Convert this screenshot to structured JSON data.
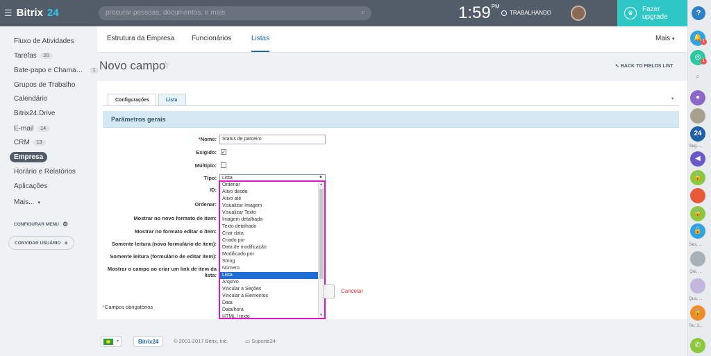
{
  "topbar": {
    "logo_text": "Bitrix",
    "logo_num": "24",
    "search_placeholder": "procurar pessoas, documentos, e mais",
    "time": "1:59",
    "ampm": "PM",
    "work_status": "TRABALHANDO",
    "upgrade_label": "Fazer upgrade",
    "help": "?"
  },
  "sidebar": {
    "items": [
      {
        "label": "Fluxo de Atividades",
        "count": ""
      },
      {
        "label": "Tarefas",
        "count": "20"
      },
      {
        "label": "Bate-papo e Chama…",
        "count": "1"
      },
      {
        "label": "Grupos de Trabalho",
        "count": ""
      },
      {
        "label": "Calendário",
        "count": ""
      },
      {
        "label": "Bitrix24.Drive",
        "count": ""
      },
      {
        "label": "E-mail",
        "count": "14"
      },
      {
        "label": "CRM",
        "count": "13"
      },
      {
        "label": "Empresa",
        "count": ""
      },
      {
        "label": "Horário e Relatórios",
        "count": ""
      },
      {
        "label": "Aplicações",
        "count": ""
      },
      {
        "label": "Mais...",
        "count": ""
      }
    ],
    "config_menu": "CONFIGURAR MENU",
    "invite_user": "CONVIDAR USUÁRIO"
  },
  "top_tabs": {
    "estrutura": "Estrutura da Empresa",
    "funcionarios": "Funcionários",
    "listas": "Listas",
    "mais": "Mais"
  },
  "page": {
    "title": "Novo campo",
    "back_link": "BACK TO FIELDS LIST"
  },
  "form": {
    "tabs": [
      "Configurações",
      "Lista"
    ],
    "section_title": "Parâmetros gerais",
    "labels": {
      "nome": "Nome:",
      "exigido": "Exigido:",
      "multiplo": "Múltiplo:",
      "tipo": "Tipo:",
      "id": "ID:",
      "ordenar": "Ordenar:",
      "mostrar_novo": "Mostrar no novo formato de item:",
      "mostrar_editar": "Mostrar no formato editar o item:",
      "somente_novo": "Somente leitura (novo formulário de item):",
      "somente_editar": "Somente leitura (formulário de editar item):",
      "mostrar_link": "Mostrar o campo ao criar um link de item da lista:"
    },
    "nome_value": "Status de parceiro",
    "exigido_checked": true,
    "multiplo_checked": false,
    "tipo_selected": "Lista",
    "tipo_options": [
      "Ordenar",
      "Ativo desde",
      "Ativo até",
      "Visualizar Imagem",
      "Visualizar Texto",
      "Imagem detalhada",
      "Texto detalhado",
      "Criar data",
      "Criado por",
      "Data de modificação",
      "Modificado por",
      "String",
      "Número",
      "Lista",
      "Arquivo",
      "Vincular a Seções",
      "Vincular a Elementos",
      "Data",
      "Data/hora",
      "HTML / texto"
    ],
    "cancel_label": "Cancelar",
    "required_note": "Campos obrigatórios"
  },
  "right_panel": {
    "labels": [
      "Seg, ...",
      "Sex, ...",
      "Qui, ...",
      "Qua, ...",
      "Ter, 2..."
    ]
  },
  "footer": {
    "brand": "Bitrix24",
    "copyright": "© 2001-2017 Bitrix, Inc.",
    "support": "Suporte24"
  },
  "colors": {
    "topbar": "#535c69",
    "accent": "#2067b0",
    "upgrade": "#2fc6c6",
    "dropdown_highlight": "#d918c8"
  }
}
